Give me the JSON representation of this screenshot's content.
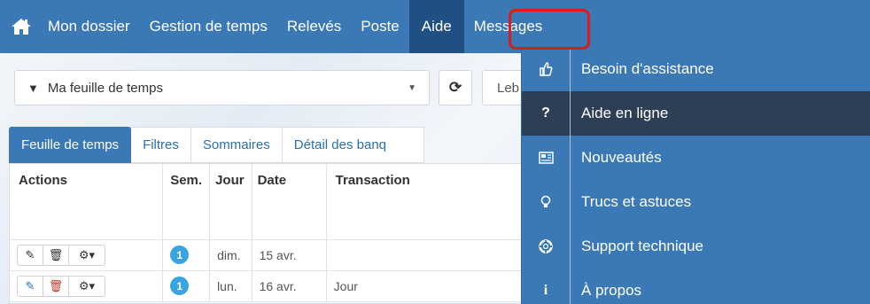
{
  "navbar": {
    "items": [
      "Mon dossier",
      "Gestion de temps",
      "Relevés",
      "Poste",
      "Aide",
      "Messages"
    ]
  },
  "filter": {
    "selected": "Ma feuille de temps",
    "period_partial": "Leb"
  },
  "tabs": [
    "Feuille de temps",
    "Filtres",
    "Sommaires",
    "Détail des banq"
  ],
  "table": {
    "headers": [
      "Actions",
      "Sem.",
      "Jour",
      "Date",
      "Transaction"
    ],
    "rows": [
      {
        "week": "1",
        "day": "dim.",
        "date": "15 avr.",
        "transaction": ""
      },
      {
        "week": "1",
        "day": "lun.",
        "date": "16 avr.",
        "transaction": "Jour"
      }
    ]
  },
  "aide_menu": {
    "items": [
      {
        "label": "Besoin d'assistance",
        "icon": "thumbs-up-icon"
      },
      {
        "label": "Aide en ligne",
        "icon": "question-icon",
        "active": true
      },
      {
        "label": "Nouveautés",
        "icon": "newspaper-icon"
      },
      {
        "label": "Trucs et astuces",
        "icon": "lightbulb-icon"
      },
      {
        "label": "Support technique",
        "icon": "lifebuoy-icon"
      },
      {
        "label": "À propos",
        "icon": "info-icon"
      }
    ]
  },
  "colors": {
    "nav": "#3a79b6",
    "aide_active": "#1f4f83",
    "menu_active": "#2e3f55",
    "highlight": "#e0191f"
  }
}
